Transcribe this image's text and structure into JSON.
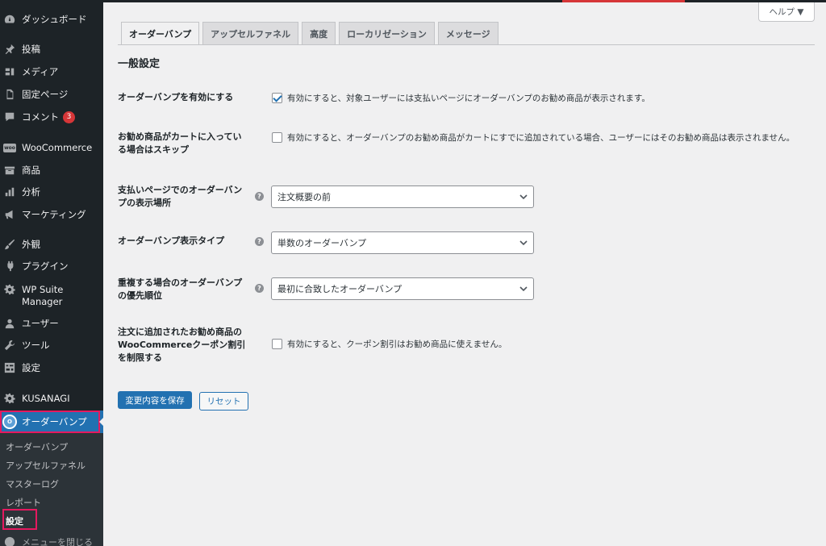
{
  "sidebar": {
    "items": [
      {
        "label": "ダッシュボード",
        "icon": "dashboard-icon"
      },
      {
        "label": "投稿",
        "icon": "pin-icon"
      },
      {
        "label": "メディア",
        "icon": "media-icon"
      },
      {
        "label": "固定ページ",
        "icon": "page-icon"
      },
      {
        "label": "コメント",
        "icon": "comment-icon",
        "badge": "3"
      },
      {
        "label": "WooCommerce",
        "icon": "woocommerce-icon"
      },
      {
        "label": "商品",
        "icon": "archive-icon"
      },
      {
        "label": "分析",
        "icon": "chart-bar-icon"
      },
      {
        "label": "マーケティング",
        "icon": "megaphone-icon"
      },
      {
        "label": "外観",
        "icon": "brush-icon"
      },
      {
        "label": "プラグイン",
        "icon": "plugin-icon"
      },
      {
        "label": "WP Suite Manager",
        "icon": "gear-icon"
      },
      {
        "label": "ユーザー",
        "icon": "user-icon"
      },
      {
        "label": "ツール",
        "icon": "wrench-icon"
      },
      {
        "label": "設定",
        "icon": "settings-icon"
      },
      {
        "label": "KUSANAGI",
        "icon": "gear-icon"
      },
      {
        "label": "オーダーバンプ",
        "icon": "order-bump-icon"
      }
    ],
    "submenu": [
      "オーダーバンプ",
      "アップセルファネル",
      "マスターログ",
      "レポート",
      "設定"
    ],
    "collapse_label": "メニューを閉じる"
  },
  "help_label": "ヘルプ ▼",
  "tabs": [
    "オーダーバンプ",
    "アップセルファネル",
    "高度",
    "ローカリゼーション",
    "メッセージ"
  ],
  "section_title": "一般設定",
  "rows": [
    {
      "label": "オーダーバンプを有効にする",
      "text": "有効にすると、対象ユーザーには支払いページにオーダーバンプのお勧め商品が表示されます。",
      "checked": true
    },
    {
      "label": "お勧め商品がカートに入っている場合はスキップ",
      "text": "有効にすると、オーダーバンプのお勧め商品がカートにすでに追加されている場合、ユーザーにはそのお勧め商品は表示されません。",
      "checked": false
    },
    {
      "label": "支払いページでのオーダーバンプの表示場所",
      "value": "注文概要の前"
    },
    {
      "label": "オーダーバンプ表示タイプ",
      "value": "単数のオーダーバンプ"
    },
    {
      "label": "重複する場合のオーダーバンプの優先順位",
      "value": "最初に合致したオーダーバンプ"
    },
    {
      "label": "注文に追加されたお勧め商品のWooCommerceクーポン割引を制限する",
      "text": "有効にすると、クーポン割引はお勧め商品に使えません。",
      "checked": false
    }
  ],
  "buttons": {
    "save": "変更内容を保存",
    "reset": "リセット"
  }
}
